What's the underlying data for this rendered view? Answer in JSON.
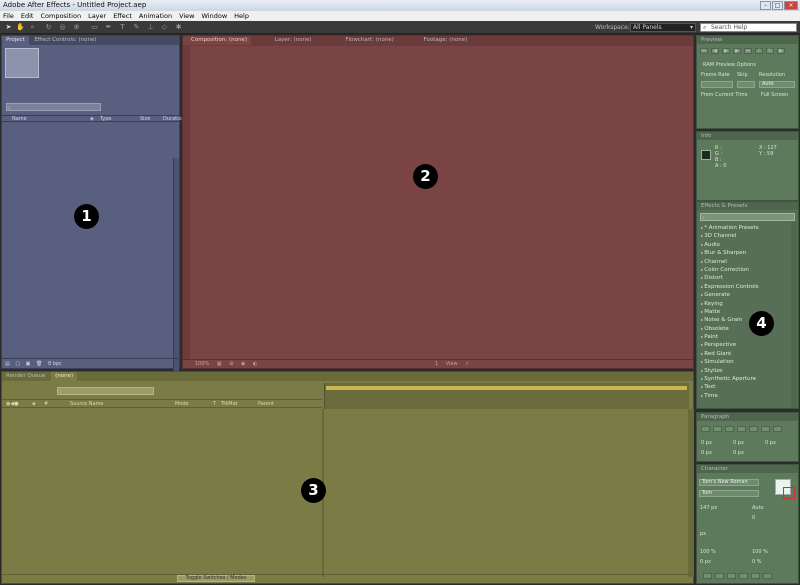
{
  "window": {
    "title": "Adobe After Effects - Untitled Project.aep",
    "minimize": "–",
    "maximize": "□",
    "close": "×"
  },
  "menu": [
    "File",
    "Edit",
    "Composition",
    "Layer",
    "Effect",
    "Animation",
    "View",
    "Window",
    "Help"
  ],
  "toolbar": {
    "workspace_label": "Workspace:",
    "workspace_value": "All Panels",
    "help_search_placeholder": "Search Help"
  },
  "project_panel": {
    "tabs": [
      "Project",
      "Effect Controls: (none)"
    ],
    "columns": [
      "Name",
      "Type",
      "Size",
      "Duration"
    ],
    "bpc": "8 bpc"
  },
  "composition_panel": {
    "tabs": [
      "Composition: (none)",
      "Layer: (none)",
      "Flowchart: (none)",
      "Footage: (none)"
    ],
    "bottom_zoom": "100%",
    "bottom_view": "1 View"
  },
  "timeline_panel": {
    "tabs": [
      "Render Queue",
      "(none)"
    ],
    "columns": [
      "Source Name",
      "Mode",
      "T",
      "TrkMat",
      "Parent"
    ],
    "toggle_label": "Toggle Switches / Modes"
  },
  "preview_panel": {
    "title": "Preview",
    "options_label": "RAM Preview Options",
    "frame_rate_label": "Frame Rate",
    "skip_label": "Skip",
    "resolution_label": "Resolution",
    "resolution_value": "Auto",
    "from_current_label": "From Current Time",
    "full_screen_label": "Full Screen"
  },
  "info_panel": {
    "title": "Info",
    "r_label": "R :",
    "g_label": "G :",
    "b_label": "B :",
    "a_label": "A :  0",
    "x_label": "X : 127",
    "y_label": "Y : 59"
  },
  "effects_panel": {
    "title": "Effects & Presets",
    "items": [
      "* Animation Presets",
      "3D Channel",
      "Audio",
      "Blur & Sharpen",
      "Channel",
      "Color Correction",
      "Distort",
      "Expression Controls",
      "Generate",
      "Keying",
      "Matte",
      "Noise & Grain",
      "Obsolete",
      "Paint",
      "Perspective",
      "Red Giant",
      "Simulation",
      "Stylize",
      "Synthetic Aperture",
      "Text",
      "Time"
    ]
  },
  "paragraph_panel": {
    "title": "Paragraph",
    "indent_value": "0 px"
  },
  "character_panel": {
    "title": "Character",
    "font": "Tom's New Roman",
    "style": "Tom",
    "size": "147 px",
    "leading": "Auto",
    "tracking": "0",
    "vert_scale": "100 %",
    "horiz_scale": "100 %",
    "baseline": "0 px",
    "tsume": "0 %",
    "stroke_width": "px"
  },
  "overlay_labels": [
    "1",
    "2",
    "3",
    "4"
  ],
  "colors": {
    "project": "#59607f",
    "composition": "#7a4444",
    "timeline": "#7b7c45",
    "right_panels": "#5d7a5d"
  }
}
